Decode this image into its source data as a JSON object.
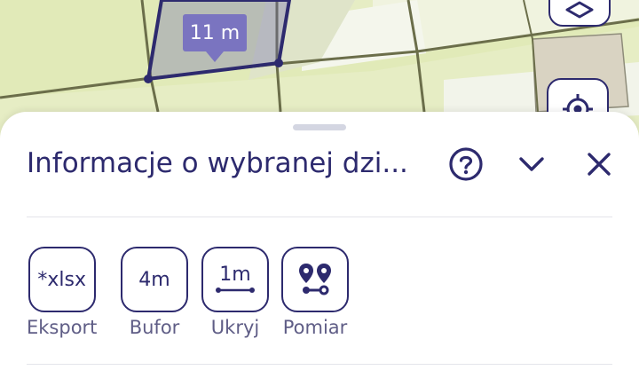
{
  "map": {
    "measurement_label": "11 m",
    "layers_button": "layers-icon",
    "locate_button": "locate-icon"
  },
  "panel": {
    "title": "Informacje o wybranej dzi...",
    "help_icon": "help-icon",
    "collapse_icon": "chevron-down-icon",
    "close_icon": "close-icon"
  },
  "tools": [
    {
      "box": "*xlsx",
      "label": "Eksport"
    },
    {
      "box": "4m",
      "label": "Bufor"
    },
    {
      "box": "1m",
      "label": "Ukryj"
    },
    {
      "box": "",
      "label": "Pomiar"
    }
  ],
  "colors": {
    "primary": "#2d2a6e",
    "map_green": "#e6edc4",
    "map_road": "#6b6e4a",
    "label_bg": "#7a74c0"
  }
}
